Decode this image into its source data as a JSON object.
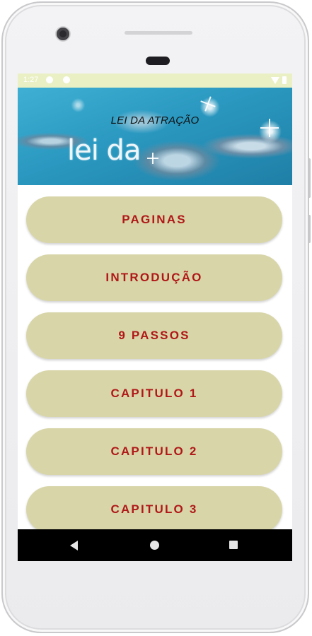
{
  "status_bar": {
    "time": "1:27",
    "icons": [
      "status-icon-a",
      "status-icon-b",
      "wifi-icon",
      "battery-icon"
    ]
  },
  "header": {
    "title": "LEI DA ATRAÇÃO",
    "logo_text": "lei da"
  },
  "menu": {
    "items": [
      {
        "label": "PAGINAS"
      },
      {
        "label": "INTRODUÇÃO"
      },
      {
        "label": "9 PASSOS"
      },
      {
        "label": "CAPITULO 1"
      },
      {
        "label": "CAPITULO 2"
      },
      {
        "label": "CAPITULO 3"
      }
    ]
  },
  "nav_bar": {
    "icons": [
      "back-icon",
      "home-icon",
      "recents-icon"
    ]
  },
  "colors": {
    "button_bg": "#d8d6a9",
    "button_text": "#b01818",
    "status_bar_bg": "#eaf0c4",
    "nav_bar_bg": "#000000"
  }
}
